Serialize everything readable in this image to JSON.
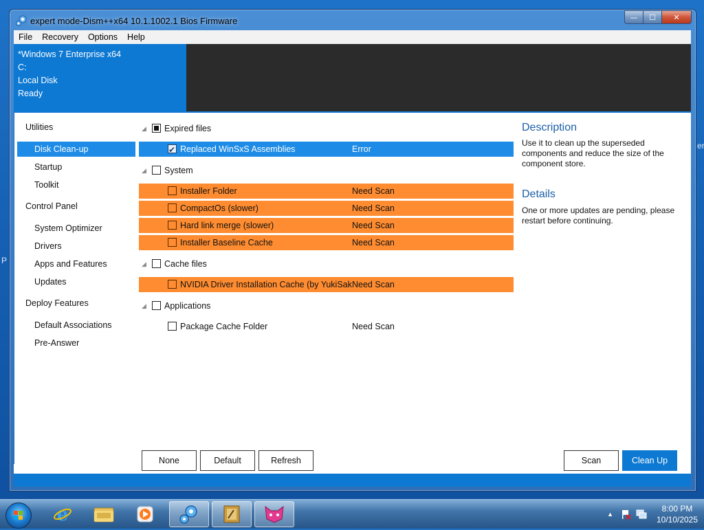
{
  "window": {
    "title": "expert mode-Dism++x64 10.1.1002.1 Bios Firmware",
    "caption_min": "—",
    "caption_max": "☐",
    "caption_close": "✕"
  },
  "menu": [
    "File",
    "Recovery",
    "Options",
    "Help"
  ],
  "header": {
    "os": "*Windows 7 Enterprise x64",
    "drive": "C:",
    "disk": "Local Disk",
    "status": "Ready"
  },
  "sidebar": {
    "groups": [
      {
        "label": "Utilities"
      },
      {
        "label": "Control Panel"
      },
      {
        "label": "Deploy Features"
      }
    ],
    "items": [
      {
        "label": "Disk Clean-up"
      },
      {
        "label": "Startup"
      },
      {
        "label": "Toolkit"
      },
      {
        "label": "System Optimizer"
      },
      {
        "label": "Drivers"
      },
      {
        "label": "Apps and Features"
      },
      {
        "label": "Updates"
      },
      {
        "label": "Default Associations"
      },
      {
        "label": "Pre-Answer"
      }
    ]
  },
  "tree": {
    "categories": [
      {
        "label": "Expired files",
        "state": "partial"
      },
      {
        "label": "System",
        "state": "unchecked"
      },
      {
        "label": "Cache files",
        "state": "unchecked"
      },
      {
        "label": "Applications",
        "state": "unchecked"
      }
    ],
    "items": [
      {
        "label": "Replaced WinSxS Assemblies",
        "status": "Error",
        "checked": true
      },
      {
        "label": "Installer Folder",
        "status": "Need Scan",
        "checked": false
      },
      {
        "label": "CompactOs (slower)",
        "status": "Need Scan",
        "checked": false
      },
      {
        "label": "Hard link merge (slower)",
        "status": "Need Scan",
        "checked": false
      },
      {
        "label": "Installer Baseline Cache",
        "status": "Need Scan",
        "checked": false
      },
      {
        "label": "NVIDIA Driver Installation Cache (by YukiSakura",
        "status": "Need Scan",
        "checked": false
      },
      {
        "label": "Package Cache Folder",
        "status": "Need Scan",
        "checked": false
      }
    ]
  },
  "details_panel": {
    "description_title": "Description",
    "description_text": "Use it to clean up the superseded components and reduce the size of the component store.",
    "details_title": "Details",
    "details_text": "One or more updates are pending, please restart before continuing."
  },
  "buttons": {
    "none": "None",
    "default": "Default",
    "refresh": "Refresh",
    "scan": "Scan",
    "clean_up": "Clean Up"
  },
  "taskbar": {
    "time": "8:00 PM",
    "date": "10/10/2025"
  },
  "colors": {
    "accent_blue": "#0d79d3",
    "selected_blue": "#1e8ce6",
    "highlight_orange": "#ff8c30",
    "header_dark": "#2b2b2b"
  }
}
